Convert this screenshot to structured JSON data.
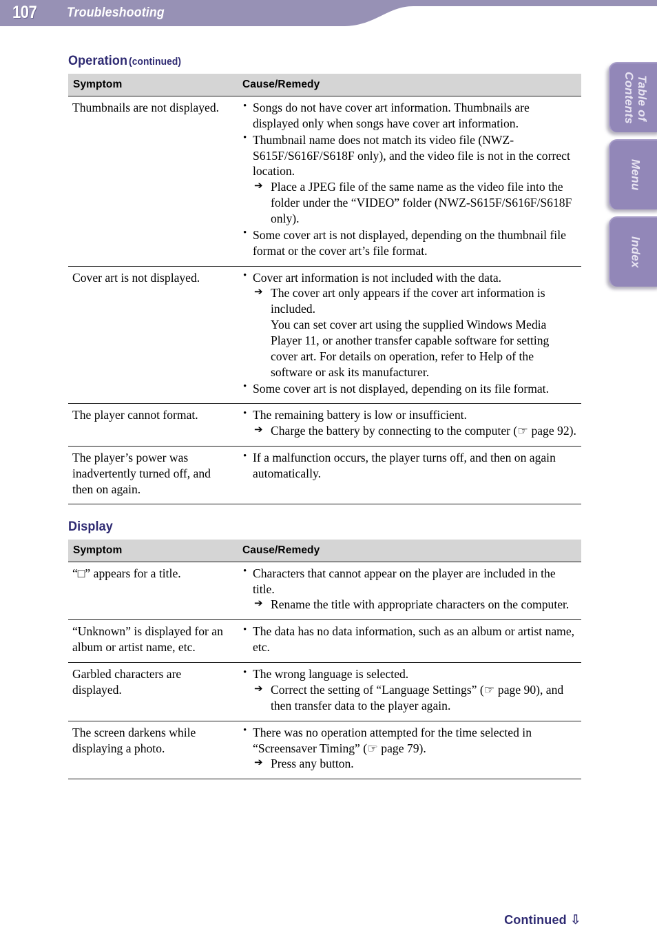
{
  "header": {
    "page_number": "107",
    "chapter_title": "Troubleshooting",
    "band_color": "#9791b5"
  },
  "side_tabs": [
    {
      "name": "table-of-contents",
      "label": "Table of\nContents"
    },
    {
      "name": "menu",
      "label": "Menu"
    },
    {
      "name": "index",
      "label": "Index"
    }
  ],
  "sections": [
    {
      "heading": "Operation",
      "heading_suffix": "(continued)",
      "columns": {
        "symptom": "Symptom",
        "remedy": "Cause/Remedy"
      },
      "rows": [
        {
          "symptom": "Thumbnails are not displayed.",
          "bullets": [
            {
              "text": "Songs do not have cover art information. Thumbnails are displayed only when songs have cover art information."
            },
            {
              "text": "Thumbnail name does not match its video file (NWZ-S615F/S616F/S618F only), and the video file is not in the correct location.",
              "arrow": "Place a JPEG file of the same name as the video file into the folder under the “VIDEO” folder (NWZ-S615F/S616F/S618F only)."
            },
            {
              "text": "Some cover art is not displayed, depending on the thumbnail file format or the cover art’s file format."
            }
          ]
        },
        {
          "symptom": "Cover art is not displayed.",
          "bullets": [
            {
              "text": "Cover art information is not included with the data.",
              "arrow": "The cover art only appears if the cover art information is included.",
              "arrow_cont": "You can set cover art using the supplied Windows Media Player 11, or another transfer capable software for setting cover art. For details on operation, refer to Help of the software or ask its manufacturer."
            },
            {
              "text": "Some cover art is not displayed, depending on its file format."
            }
          ]
        },
        {
          "symptom": "The player cannot format.",
          "bullets": [
            {
              "text": "The remaining battery is low or insufficient.",
              "arrow": "Charge the battery by connecting to the computer (☞ page 92)."
            }
          ]
        },
        {
          "symptom": "The player’s power was inadvertently turned off, and then on again.",
          "bullets": [
            {
              "text": "If a malfunction occurs, the player turns off, and then on again automatically."
            }
          ]
        }
      ]
    },
    {
      "heading": "Display",
      "heading_suffix": "",
      "columns": {
        "symptom": "Symptom",
        "remedy": "Cause/Remedy"
      },
      "rows": [
        {
          "symptom": "“□” appears for a title.",
          "bullets": [
            {
              "text": "Characters that cannot appear on the player are included in the title.",
              "arrow": "Rename the title with appropriate characters on the computer."
            }
          ]
        },
        {
          "symptom": "“Unknown” is displayed for an album or artist name, etc.",
          "bullets": [
            {
              "text": "The data has no data information, such as an album or artist name, etc."
            }
          ]
        },
        {
          "symptom": "Garbled characters are displayed.",
          "bullets": [
            {
              "text": "The wrong language is selected.",
              "arrow": "Correct the setting of “Language Settings” (☞ page 90), and then transfer data to the player again."
            }
          ]
        },
        {
          "symptom": "The screen darkens while displaying a photo.",
          "bullets": [
            {
              "text": "There was no operation attempted for the time selected in “Screensaver Timing” (☞ page 79)."
            },
            {
              "text": "",
              "arrow": "Press any button.",
              "arrow_only": true
            }
          ]
        }
      ]
    }
  ],
  "footer": {
    "continued_label": "Continued",
    "arrow_glyph": "⇩"
  }
}
